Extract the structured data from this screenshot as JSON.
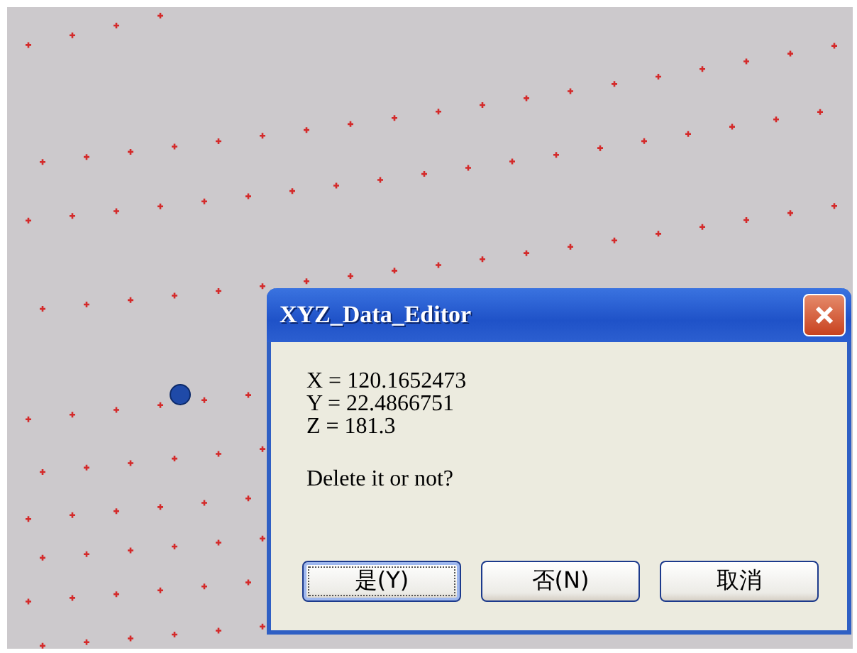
{
  "dialog": {
    "title": "XYZ_Data_Editor",
    "lines": [
      "X = 120.1652473",
      "Y = 22.4866751",
      "Z = 181.3"
    ],
    "message": "Delete it or not?",
    "buttons": [
      {
        "label": "是(Y)",
        "focused": true
      },
      {
        "label": "否(N)",
        "focused": false
      },
      {
        "label": "取消",
        "focused": false
      }
    ]
  }
}
